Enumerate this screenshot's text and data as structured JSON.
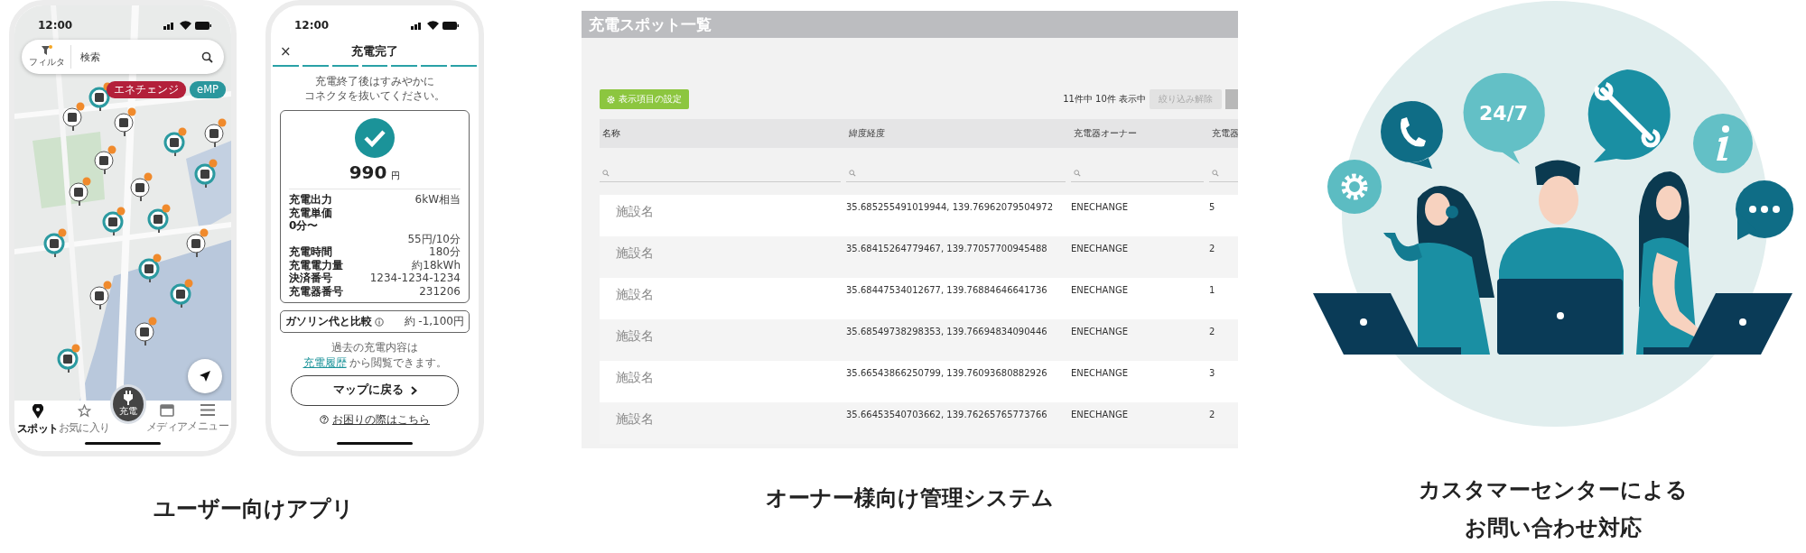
{
  "user_app": {
    "status_time": "12:00",
    "search": {
      "filter_label": "フィルタ",
      "placeholder": "検索"
    },
    "map_tags": [
      {
        "label": "エネチェンジ",
        "color": "#b3203a"
      },
      {
        "label": "eMP",
        "color": "#2a979d"
      }
    ],
    "nav": [
      {
        "kind": "tab",
        "label": "スポット",
        "selected": true
      },
      {
        "kind": "tab",
        "label": "お気に入り",
        "selected": false
      },
      {
        "kind": "center",
        "label": "充電",
        "selected": false
      },
      {
        "kind": "tab",
        "label": "メディア",
        "selected": false
      },
      {
        "kind": "tab",
        "label": "メニュー",
        "selected": false
      }
    ]
  },
  "charge_app": {
    "status_time": "12:00",
    "close": "×",
    "title": "充電完了",
    "steps": [
      {
        "done": true
      },
      {
        "done": true
      },
      {
        "done": true
      },
      {
        "done": true
      },
      {
        "done": true
      },
      {
        "done": true
      },
      {
        "done": true
      }
    ],
    "message": [
      "充電終了後はすみやかに",
      "コネクタを抜いてください。"
    ],
    "amount": "990",
    "currency": "円",
    "details": [
      {
        "label": "充電出力",
        "value": "6kW相当"
      },
      {
        "label": "充電単価"
      },
      {
        "label": "0分〜"
      },
      {
        "value": "55円/10分"
      },
      {
        "label": "充電時間",
        "value": "180分"
      },
      {
        "label": "充電電力量",
        "value": "約18kWh"
      },
      {
        "label": "決済番号",
        "value": "1234-1234-1234"
      },
      {
        "label": "充電器番号",
        "value": "231206"
      }
    ],
    "comparison": {
      "label": "ガソリン代と比較",
      "value": "約 -1,100円"
    },
    "history_note": {
      "text": "過去の充電内容は",
      "link": "充電履歴",
      "after": "から閲覧できます。"
    },
    "back_button": "マップに戻る",
    "help_link": "お困りの際はこちら"
  },
  "admin": {
    "title": "充電スポット一覧",
    "settings_button": "表示項目の設定",
    "count": "11件中 10件 表示中",
    "clear_button": {
      "label": "絞り込み解除",
      "disabled": true
    },
    "columns": [
      "名称",
      "緯度経度",
      "充電器オーナー",
      "充電器"
    ],
    "rows": [
      [
        "施設名",
        "35.685255491019944, 139.76962079504972",
        "ENECHANGE",
        "5"
      ],
      [
        "施設名",
        "35.68415264779467, 139.77057700945488",
        "ENECHANGE",
        "2"
      ],
      [
        "施設名",
        "35.68447534012677, 139.76884646641736",
        "ENECHANGE",
        "1"
      ],
      [
        "施設名",
        "35.68549738298353, 139.76694834090446",
        "ENECHANGE",
        "2"
      ],
      [
        "施設名",
        "35.66543866250799, 139.76093680882926",
        "ENECHANGE",
        "3"
      ],
      [
        "施設名",
        "35.66453540703662, 139.76265765773766",
        "ENECHANGE",
        "2"
      ]
    ]
  },
  "support": {
    "badge": "24/7"
  },
  "captions": [
    {
      "lines": [
        "ユーザー向けアプリ"
      ]
    },
    {
      "lines": [
        "オーナー様向け管理システム"
      ]
    },
    {
      "lines": [
        "カスタマーセンターによる",
        "お問い合わせ対応"
      ]
    }
  ]
}
